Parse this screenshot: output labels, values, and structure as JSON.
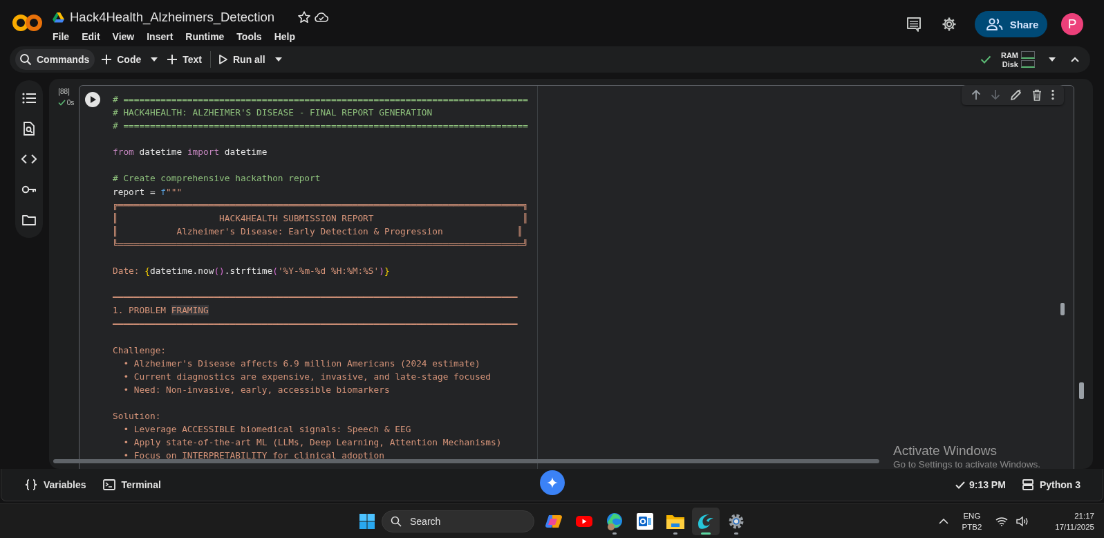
{
  "notebook": {
    "title": "Hack4Health_Alzheimers_Detection",
    "starred": false
  },
  "menu": [
    "File",
    "Edit",
    "View",
    "Insert",
    "Runtime",
    "Tools",
    "Help"
  ],
  "header_actions": {
    "share": "Share",
    "avatar": "P"
  },
  "toolbar": {
    "items": [
      {
        "kind": "search",
        "label": "Commands",
        "dropdown": false
      },
      {
        "kind": "add",
        "label": "Code",
        "dropdown": true
      },
      {
        "kind": "add",
        "label": "Text",
        "dropdown": false
      },
      {
        "kind": "run",
        "label": "Run all",
        "dropdown": true
      }
    ],
    "resources": {
      "connected": true,
      "ram_label": "RAM",
      "disk_label": "Disk"
    }
  },
  "sidebar": {
    "items": [
      {
        "kind": "toc"
      },
      {
        "kind": "find"
      },
      {
        "kind": "snippets"
      },
      {
        "kind": "secrets"
      },
      {
        "kind": "files"
      }
    ]
  },
  "cell": {
    "execution_count": "[88]",
    "duration": "0s",
    "done": true,
    "lines": [
      {
        "kind": "code",
        "segments": [
          {
            "kind": "comment",
            "text": "# ============================================================================"
          }
        ]
      },
      {
        "kind": "code",
        "segments": [
          {
            "kind": "comment",
            "text": "# HACK4HEALTH: ALZHEIMER'S DISEASE - FINAL REPORT GENERATION"
          }
        ]
      },
      {
        "kind": "code",
        "segments": [
          {
            "kind": "comment",
            "text": "# ============================================================================"
          }
        ]
      },
      {
        "kind": "blank"
      },
      {
        "kind": "code",
        "segments": [
          {
            "kind": "keyword",
            "text": "from"
          },
          {
            "kind": "plain",
            "text": " datetime "
          },
          {
            "kind": "keyword",
            "text": "import"
          },
          {
            "kind": "plain",
            "text": " datetime"
          }
        ]
      },
      {
        "kind": "blank"
      },
      {
        "kind": "code",
        "segments": [
          {
            "kind": "comment",
            "text": "# Create comprehensive hackathon report"
          }
        ]
      },
      {
        "kind": "code",
        "segments": [
          {
            "kind": "plain",
            "text": "report = "
          },
          {
            "kind": "prefix",
            "text": "f"
          },
          {
            "kind": "string",
            "text": "\"\"\""
          }
        ]
      },
      {
        "kind": "code",
        "segments": [
          {
            "kind": "string",
            "text": "╔════════════════════════════════════════════════════════════════════════════╗"
          }
        ]
      },
      {
        "kind": "code",
        "segments": [
          {
            "kind": "string",
            "text": "║                   HACK4HEALTH SUBMISSION REPORT                            ║"
          }
        ]
      },
      {
        "kind": "code",
        "segments": [
          {
            "kind": "string",
            "text": "║           Alzheimer's Disease: Early Detection & Progression              ║"
          }
        ]
      },
      {
        "kind": "code",
        "segments": [
          {
            "kind": "string",
            "text": "╚════════════════════════════════════════════════════════════════════════════╝"
          }
        ]
      },
      {
        "kind": "blank"
      },
      {
        "kind": "code",
        "segments": [
          {
            "kind": "string",
            "text": "Date: "
          },
          {
            "kind": "brace",
            "text": "{"
          },
          {
            "kind": "plain",
            "text": "datetime.now"
          },
          {
            "kind": "paren",
            "text": "()"
          },
          {
            "kind": "plain",
            "text": ".strftime"
          },
          {
            "kind": "paren",
            "text": "("
          },
          {
            "kind": "string",
            "text": "'%Y-%m-%d %H:%M:%S'"
          },
          {
            "kind": "paren",
            "text": ")"
          },
          {
            "kind": "brace",
            "text": "}"
          }
        ]
      },
      {
        "kind": "blank"
      },
      {
        "kind": "code",
        "segments": [
          {
            "kind": "string",
            "text": "━━━━━━━━━━━━━━━━━━━━━━━━━━━━━━━━━━━━━━━━━━━━━━━━━━━━━━━━━━━━━━━━━━━━━━━━━━━━"
          }
        ]
      },
      {
        "kind": "code",
        "segments": [
          {
            "kind": "string",
            "text": "1. PROBLEM "
          },
          {
            "kind": "string",
            "text": "FRAMING",
            "highlighted": true
          }
        ]
      },
      {
        "kind": "code",
        "segments": [
          {
            "kind": "string",
            "text": "━━━━━━━━━━━━━━━━━━━━━━━━━━━━━━━━━━━━━━━━━━━━━━━━━━━━━━━━━━━━━━━━━━━━━━━━━━━━"
          }
        ]
      },
      {
        "kind": "blank"
      },
      {
        "kind": "code",
        "segments": [
          {
            "kind": "string",
            "text": "Challenge:"
          }
        ]
      },
      {
        "kind": "code",
        "segments": [
          {
            "kind": "string",
            "text": "  • Alzheimer's Disease affects 6.9 million Americans (2024 estimate)"
          }
        ]
      },
      {
        "kind": "code",
        "segments": [
          {
            "kind": "string",
            "text": "  • Current diagnostics are expensive, invasive, and late-stage focused"
          }
        ]
      },
      {
        "kind": "code",
        "segments": [
          {
            "kind": "string",
            "text": "  • Need: Non-invasive, early, accessible biomarkers"
          }
        ]
      },
      {
        "kind": "blank"
      },
      {
        "kind": "code",
        "segments": [
          {
            "kind": "string",
            "text": "Solution:"
          }
        ]
      },
      {
        "kind": "code",
        "segments": [
          {
            "kind": "string",
            "text": "  • Leverage ACCESSIBLE biomedical signals: Speech & EEG"
          }
        ]
      },
      {
        "kind": "code",
        "segments": [
          {
            "kind": "string",
            "text": "  • Apply state-of-the-art ML (LLMs, Deep Learning, Attention Mechanisms)"
          }
        ]
      },
      {
        "kind": "code",
        "segments": [
          {
            "kind": "string",
            "text": "  • Focus on INTERPRETABILITY for clinical adoption"
          }
        ]
      }
    ]
  },
  "status_bar": {
    "items": [
      {
        "kind": "variables",
        "label": "Variables"
      },
      {
        "kind": "terminal",
        "label": "Terminal"
      }
    ],
    "saved": true,
    "time": "9:13 PM",
    "runtime": "Python 3"
  },
  "os_notice": {
    "title": "Activate Windows",
    "subtitle": "Go to Settings to activate Windows."
  },
  "taskbar": {
    "search_placeholder": "Search",
    "apps": [
      {
        "kind": "copilot",
        "running": false,
        "active": false
      },
      {
        "kind": "youtube",
        "running": false,
        "active": false
      },
      {
        "kind": "edge",
        "running": true,
        "active": false
      },
      {
        "kind": "outlook",
        "running": false,
        "active": false
      },
      {
        "kind": "explorer",
        "running": true,
        "active": false
      },
      {
        "kind": "wave",
        "running": true,
        "active": true
      },
      {
        "kind": "settings",
        "running": true,
        "active": false
      }
    ],
    "tray": {
      "language": "ENG",
      "layout": "PTB2",
      "time": "21:17",
      "date": "17/11/2025"
    }
  }
}
